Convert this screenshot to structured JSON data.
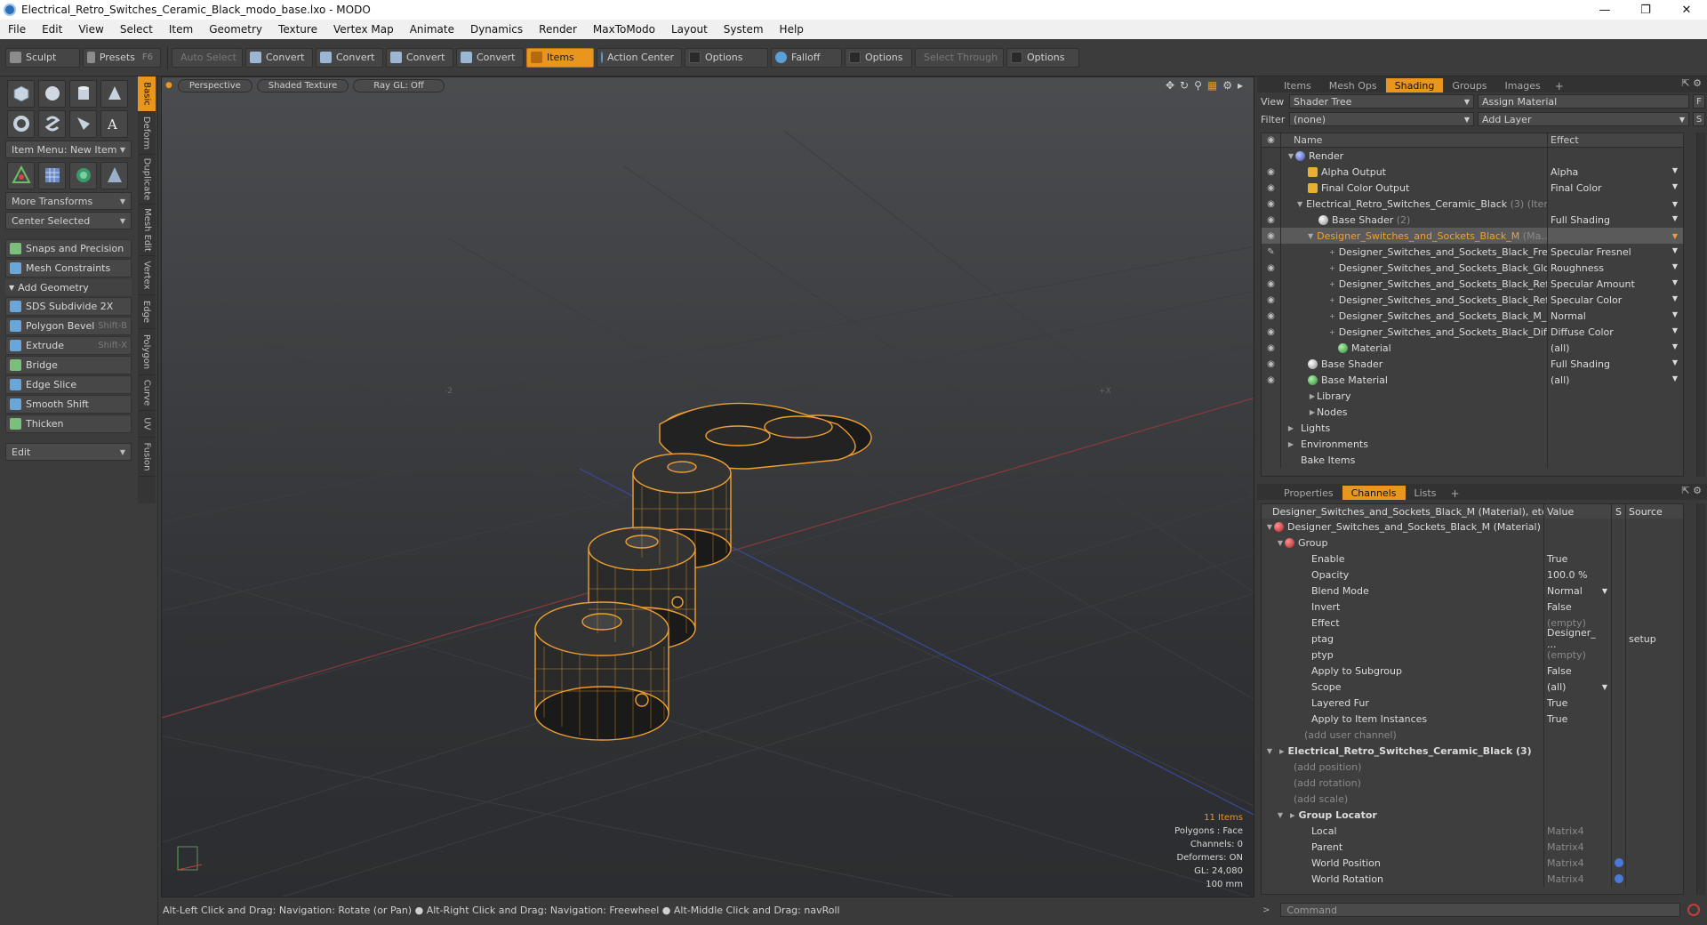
{
  "window": {
    "title": "Electrical_Retro_Switches_Ceramic_Black_modo_base.lxo - MODO"
  },
  "menu": [
    "File",
    "Edit",
    "View",
    "Select",
    "Item",
    "Geometry",
    "Texture",
    "Vertex Map",
    "Animate",
    "Dynamics",
    "Render",
    "MaxToModo",
    "Layout",
    "System",
    "Help"
  ],
  "toolbar": {
    "sculpt": "Sculpt",
    "presets": "Presets",
    "presets_key": "F6",
    "auto_select": "Auto Select",
    "convert1": "Convert",
    "convert2": "Convert",
    "convert3": "Convert",
    "convert4": "Convert",
    "items": "Items",
    "action_center": "Action Center",
    "options1": "Options",
    "falloff": "Falloff",
    "options2": "Options",
    "select_through": "Select Through",
    "options3": "Options"
  },
  "left": {
    "item_menu": "Item Menu: New Item",
    "more_transforms": "More Transforms",
    "center_selected": "Center Selected",
    "snaps": "Snaps and Precision",
    "mesh_constraints": "Mesh Constraints",
    "add_geometry": "Add Geometry",
    "tools": [
      {
        "label": "SDS Subdivide 2X",
        "key": ""
      },
      {
        "label": "Polygon Bevel",
        "key": "Shift-B"
      },
      {
        "label": "Extrude",
        "key": "Shift-X"
      },
      {
        "label": "Bridge",
        "key": ""
      },
      {
        "label": "Edge Slice",
        "key": ""
      },
      {
        "label": "Smooth Shift",
        "key": ""
      },
      {
        "label": "Thicken",
        "key": ""
      }
    ],
    "edit": "Edit",
    "vtabs": [
      "Basic",
      "Deform",
      "Duplicate",
      "Mesh Edit",
      "Vertex",
      "Edge",
      "Polygon",
      "Curve",
      "UV",
      "Fusion"
    ]
  },
  "viewport": {
    "perspective": "Perspective",
    "shaded": "Shaded Texture",
    "raygl": "Ray GL: Off",
    "info": {
      "items": "11 Items",
      "polygons": "Polygons : Face",
      "channels": "Channels: 0",
      "deformers": "Deformers: ON",
      "gl": "GL: 24,080",
      "scale": "100 mm"
    }
  },
  "status": "Alt-Left Click and Drag: Navigation: Rotate (or Pan) ●  Alt-Right Click and Drag: Navigation: Freewheel ●  Alt-Middle Click and Drag: navRoll",
  "shading": {
    "tabs": [
      "Items",
      "Mesh Ops",
      "Shading",
      "Groups",
      "Images"
    ],
    "view_label": "View",
    "view_value": "Shader Tree",
    "assign": "Assign Material",
    "filter_label": "Filter",
    "filter_value": "(none)",
    "add_layer": "Add Layer",
    "col_name": "Name",
    "col_effect": "Effect",
    "rows": [
      {
        "name": "Render",
        "extra": "",
        "effect": ""
      },
      {
        "name": "Alpha Output",
        "extra": "",
        "effect": "Alpha"
      },
      {
        "name": "Final Color Output",
        "extra": "",
        "effect": "Final Color"
      },
      {
        "name": "Electrical_Retro_Switches_Ceramic_Black",
        "extra": "(3) (Item)",
        "effect": ""
      },
      {
        "name": "Base Shader",
        "extra": "(2)",
        "effect": "Full Shading"
      },
      {
        "name": "Designer_Switches_and_Sockets_Black_M",
        "extra": "(Ma...",
        "effect": ""
      },
      {
        "name": "Designer_Switches_and_Sockets_Black_Fre ...",
        "extra": "",
        "effect": "Specular Fresnel"
      },
      {
        "name": "Designer_Switches_and_Sockets_Black_Glo ...",
        "extra": "",
        "effect": "Roughness"
      },
      {
        "name": "Designer_Switches_and_Sockets_Black_Refl...",
        "extra": "",
        "effect": "Specular Amount"
      },
      {
        "name": "Designer_Switches_and_Sockets_Black_Refl...",
        "extra": "",
        "effect": "Specular Color"
      },
      {
        "name": "Designer_Switches_and_Sockets_Black_M_ ...",
        "extra": "",
        "effect": "Normal"
      },
      {
        "name": "Designer_Switches_and_Sockets_Black_Diff...",
        "extra": "",
        "effect": "Diffuse Color"
      },
      {
        "name": "Material",
        "extra": "",
        "effect": "(all)"
      },
      {
        "name": "Base Shader",
        "extra": "",
        "effect": "Full Shading"
      },
      {
        "name": "Base Material",
        "extra": "",
        "effect": "(all)"
      },
      {
        "name": "Library",
        "extra": "",
        "effect": ""
      },
      {
        "name": "Nodes",
        "extra": "",
        "effect": ""
      },
      {
        "name": "Lights",
        "extra": "",
        "effect": ""
      },
      {
        "name": "Environments",
        "extra": "",
        "effect": ""
      },
      {
        "name": "Bake Items",
        "extra": "",
        "effect": ""
      }
    ]
  },
  "channels": {
    "tabs": [
      "Properties",
      "Channels",
      "Lists"
    ],
    "col_name": "Designer_Switches_and_Sockets_Black_M (Material), etc.",
    "col_value": "Value",
    "col_s": "S",
    "col_source": "Source",
    "rows": [
      {
        "name": "Designer_Switches_and_Sockets_Black_M (Material)",
        "value": "",
        "source": ""
      },
      {
        "name": "Group",
        "value": "",
        "source": ""
      },
      {
        "name": "Enable",
        "value": "True",
        "source": ""
      },
      {
        "name": "Opacity",
        "value": "100.0 %",
        "source": ""
      },
      {
        "name": "Blend Mode",
        "value": "Normal",
        "source": ""
      },
      {
        "name": "Invert",
        "value": "False",
        "source": ""
      },
      {
        "name": "Effect",
        "value": "(empty)",
        "source": ""
      },
      {
        "name": "ptag",
        "value": "Designer_ ...",
        "source": "setup"
      },
      {
        "name": "ptyp",
        "value": "(empty)",
        "source": ""
      },
      {
        "name": "Apply to Subgroup",
        "value": "False",
        "source": ""
      },
      {
        "name": "Scope",
        "value": "(all)",
        "source": ""
      },
      {
        "name": "Layered Fur",
        "value": "True",
        "source": ""
      },
      {
        "name": "Apply to Item Instances",
        "value": "True",
        "source": ""
      },
      {
        "name": "(add user channel)",
        "value": "",
        "source": ""
      },
      {
        "name": "Electrical_Retro_Switches_Ceramic_Black (3)",
        "value": "",
        "source": ""
      },
      {
        "name": "(add position)",
        "value": "",
        "source": ""
      },
      {
        "name": "(add rotation)",
        "value": "",
        "source": ""
      },
      {
        "name": "(add scale)",
        "value": "",
        "source": ""
      },
      {
        "name": "Group Locator",
        "value": "",
        "source": ""
      },
      {
        "name": "Local",
        "value": "Matrix4",
        "source": ""
      },
      {
        "name": "Parent",
        "value": "Matrix4",
        "source": ""
      },
      {
        "name": "World Position",
        "value": "Matrix4",
        "source": ""
      },
      {
        "name": "World Rotation",
        "value": "Matrix4",
        "source": ""
      }
    ]
  },
  "command": {
    "placeholder": "Command"
  }
}
